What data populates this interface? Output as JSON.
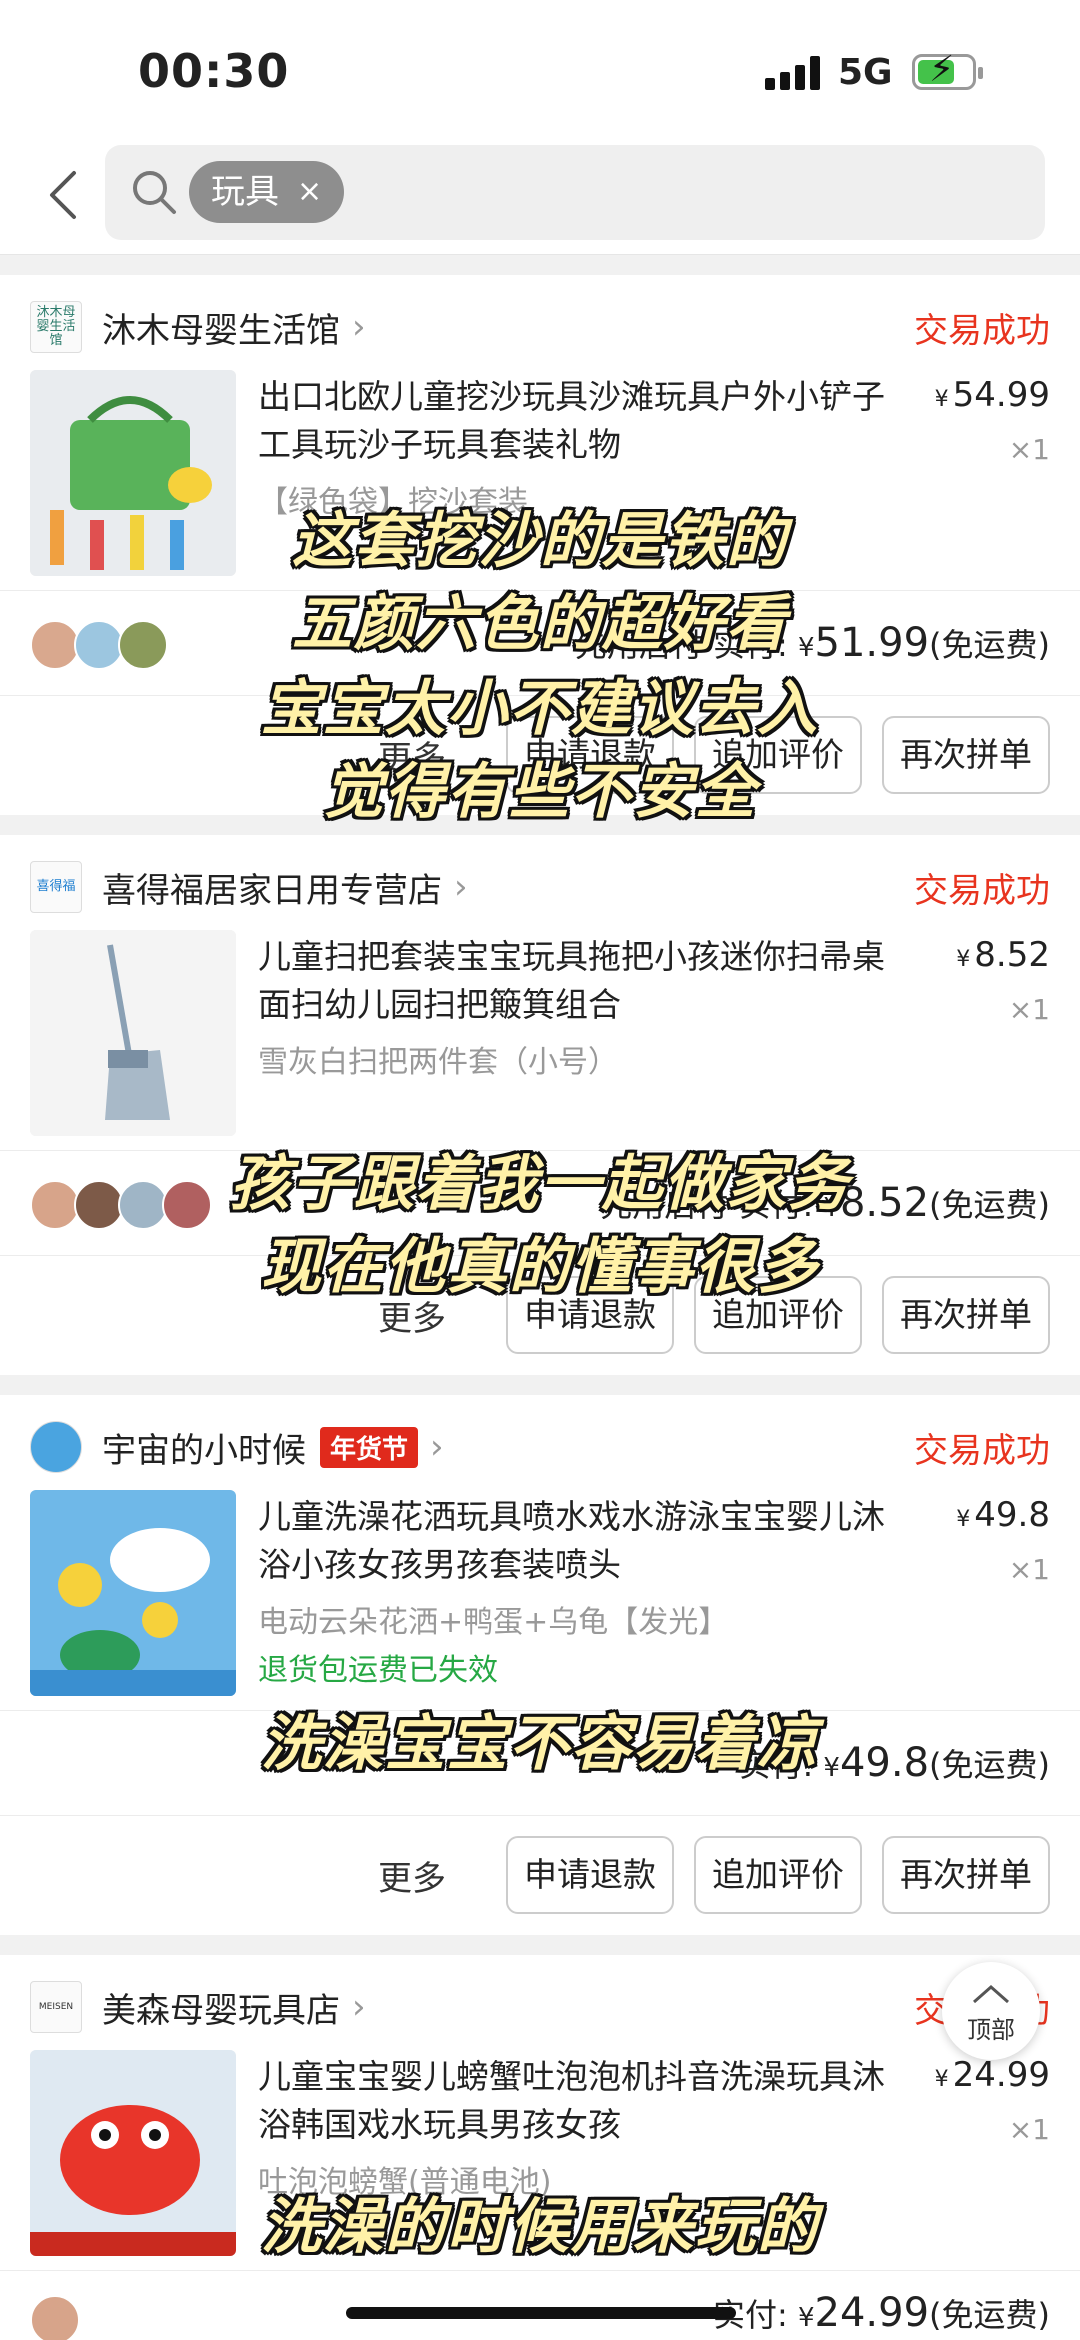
{
  "status_bar": {
    "time": "00:30",
    "network": "5G"
  },
  "search": {
    "chip_label": "玩具",
    "chip_close": "×"
  },
  "orders": [
    {
      "shop": "沐木母婴生活馆",
      "shop_logo_text": "沐木母婴生活馆",
      "status": "交易成功",
      "title": "出口北欧儿童挖沙玩具沙滩玩具户外小铲子工具玩沙子玩具套装礼物",
      "price": "54.99",
      "qty": "×1",
      "spec": "【绿色袋】挖沙套装",
      "pay_prefix": "先用后付 实付:",
      "pay_amount": "51.99",
      "shipping": "(免运费)"
    },
    {
      "shop": "喜得福居家日用专营店",
      "shop_logo_text": "喜得福",
      "status": "交易成功",
      "title": "儿童扫把套装宝宝玩具拖把小孩迷你扫帚桌面扫幼儿园扫把簸箕组合",
      "price": "8.52",
      "qty": "×1",
      "spec": "雪灰白扫把两件套（小号）",
      "pay_prefix": "先用后付 实付:",
      "pay_amount": "8.52",
      "shipping": "(免运费)"
    },
    {
      "shop": "宇宙的小时候",
      "festival": "年货节",
      "status": "交易成功",
      "title": "儿童洗澡花洒玩具喷水戏水游泳宝宝婴儿沐浴小孩女孩男孩套装喷头",
      "price": "49.8",
      "qty": "×1",
      "spec": "电动云朵花洒+鸭蛋+乌龟【发光】",
      "notice": "退货包运费已失效",
      "pay_prefix": "实付:",
      "pay_amount": "49.8",
      "shipping": "(免运费)"
    },
    {
      "shop": "美森母婴玩具店",
      "shop_logo_text": "MEISEN",
      "status": "交易成功",
      "title": "儿童宝宝婴儿螃蟹吐泡泡机抖音洗澡玩具沐浴韩国戏水玩具男孩女孩",
      "price": "24.99",
      "qty": "×1",
      "spec": "吐泡泡螃蟹(普通电池)",
      "pay_prefix": "实付:",
      "pay_amount": "24.99",
      "shipping": "(免运费)"
    }
  ],
  "actions": {
    "more": "更多",
    "refund": "申请退款",
    "review": "追加评价",
    "rebuy": "再次拼单"
  },
  "subtitles": {
    "s1": "这套挖沙的是铁的",
    "s2": "五颜六色的超好看",
    "s3": "宝宝太小不建议去入",
    "s4": "觉得有些不安全",
    "s5": "孩子跟着我一起做家务",
    "s6": "现在他真的懂事很多",
    "s7": "洗澡宝宝不容易着凉",
    "s8": "洗澡的时候用来玩的"
  },
  "top_button": "顶部",
  "currency": "¥",
  "colors": {
    "accent": "#e8341f",
    "notice_green": "#26a844",
    "subtitle": "#fff1a8"
  }
}
